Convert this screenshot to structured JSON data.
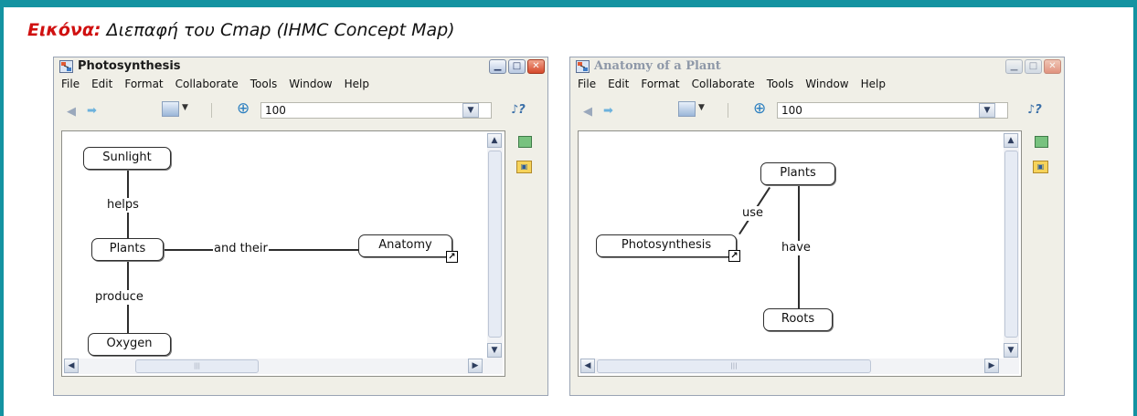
{
  "caption": {
    "lead": "Εικόνα:",
    "text": " Διεπαφή του Cmap (IHMC Concept Map)"
  },
  "menu": [
    "File",
    "Edit",
    "Format",
    "Collaborate",
    "Tools",
    "Window",
    "Help"
  ],
  "zoom_value": "100",
  "windows": [
    {
      "title": "Photosynthesis",
      "concepts": {
        "sunlight": "Sunlight",
        "plants": "Plants",
        "oxygen": "Oxygen",
        "anatomy": "Anatomy"
      },
      "links": {
        "helps": "helps",
        "and_their": "and their",
        "produce": "produce"
      }
    },
    {
      "title": "Anatomy of a Plant",
      "concepts": {
        "plants": "Plants",
        "photosynthesis": "Photosynthesis",
        "roots": "Roots"
      },
      "links": {
        "use": "use",
        "have": "have"
      }
    }
  ],
  "icons": [
    "cmap-app-icon",
    "minimize-icon",
    "maximize-icon",
    "close-icon",
    "back-arrow-icon",
    "forward-arrow-icon",
    "image-icon",
    "dropdown-arrow-icon",
    "zoom-icon",
    "chevron-down-icon",
    "style-icon",
    "view-icon",
    "collaborate-icon",
    "nested-link-icon",
    "scroll-up-icon",
    "scroll-down-icon",
    "scroll-left-icon",
    "scroll-right-icon"
  ],
  "colors": {
    "frame": "#1493a1",
    "caption_lead": "#d01010"
  }
}
